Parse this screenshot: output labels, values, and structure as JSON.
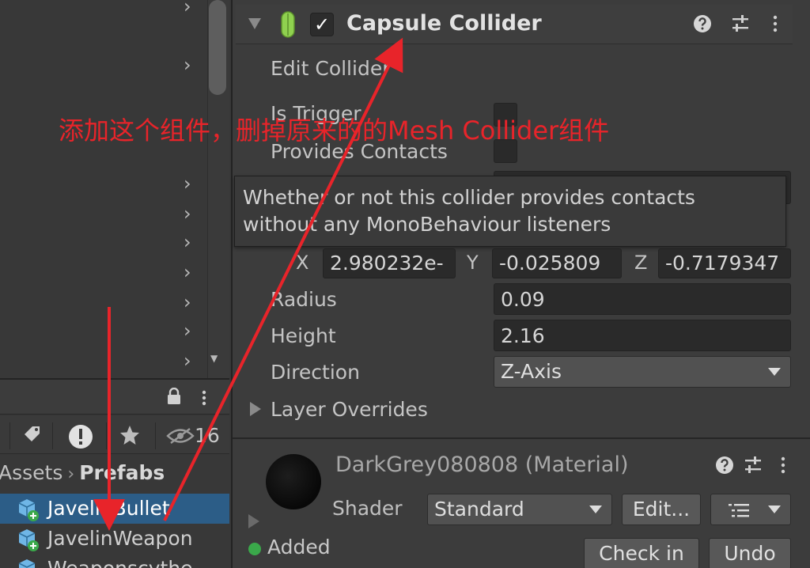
{
  "hierarchy": {
    "expand_glyph": "›"
  },
  "project": {
    "hidden_count": "16",
    "breadcrumb": {
      "root": "Assets",
      "separator": "›",
      "current": "Prefabs"
    },
    "assets": [
      {
        "label": "JavelinBullet",
        "selected": true
      },
      {
        "label": "JavelinWeapon",
        "selected": false
      },
      {
        "label": "Weaponscythe",
        "selected": false
      }
    ]
  },
  "inspector": {
    "component": {
      "title": "Capsule Collider",
      "enabled_mark": "✓",
      "edit_collider_label": "Edit Collider",
      "is_trigger_label": "Is Trigger",
      "provides_contacts_label": "Provides Contacts",
      "tooltip_line1": "Whether or not this collider provides contacts",
      "tooltip_line2": "without any MonoBehaviour listeners",
      "center": {
        "x_label": "X",
        "x_value": "2.980232e-",
        "y_label": "Y",
        "y_value": "-0.025809",
        "z_label": "Z",
        "z_value": "-0.7179347"
      },
      "radius_label": "Radius",
      "radius_value": "0.09",
      "height_label": "Height",
      "height_value": "2.16",
      "direction_label": "Direction",
      "direction_value": "Z-Axis",
      "layer_overrides_label": "Layer Overrides"
    },
    "material": {
      "title": "DarkGrey080808 (Material)",
      "shader_label": "Shader",
      "shader_value": "Standard",
      "edit_button": "Edit...",
      "added_label": "Added",
      "check_in_button": "Check in",
      "undo_button": "Undo"
    }
  },
  "annotation": {
    "text": "添加这个组件，删掉原来的的Mesh Collider组件",
    "color": "#e8242a"
  },
  "colors": {
    "selection": "#2c5d87",
    "capsule_icon": "#8fd14f",
    "added_badge": "#3aa84a"
  }
}
